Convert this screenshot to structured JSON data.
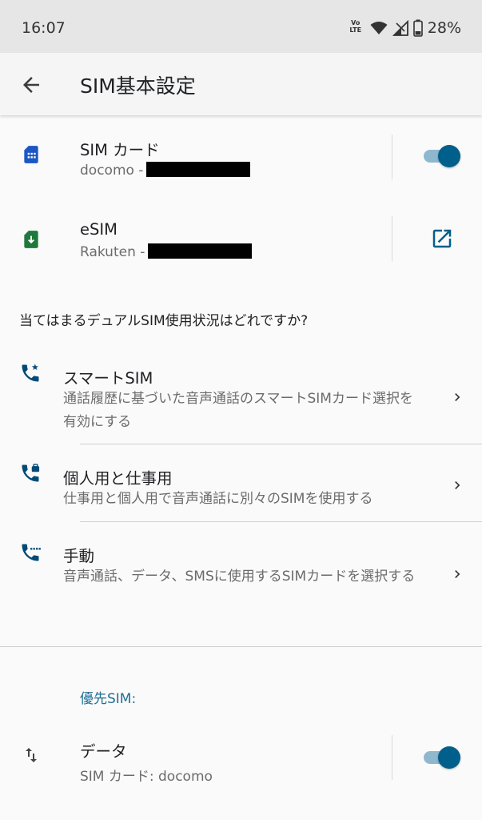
{
  "status_bar": {
    "time": "16:07",
    "volte_label": "Vo LTE",
    "battery": "28%"
  },
  "app_bar": {
    "title": "SIM基本設定"
  },
  "sims": [
    {
      "title": "SIM カード",
      "subtitle": "docomo -",
      "control": "toggle",
      "toggle_on": true,
      "icon": "sim-card-icon",
      "icon_color": "#1a56c4"
    },
    {
      "title": "eSIM",
      "subtitle": "Rakuten -",
      "control": "open-external",
      "icon": "esim-download-icon",
      "icon_color": "#1e7a3c"
    }
  ],
  "question": "当てはまるデュアルSIM使用状況はどれですか?",
  "usage_options": [
    {
      "title": "スマートSIM",
      "subtitle": "通話履歴に基づいた音声通話のスマートSIMカード選択を有効にする",
      "icon": "phone-star-icon"
    },
    {
      "title": "個人用と仕事用",
      "subtitle": "仕事用と個人用で音声通話に別々のSIMを使用する",
      "icon": "phone-briefcase-icon"
    },
    {
      "title": "手動",
      "subtitle": "音声通話、データ、SMSに使用するSIMカードを選択する",
      "icon": "phone-dialpad-icon"
    }
  ],
  "preferred": {
    "header": "優先SIM:",
    "items": [
      {
        "title": "データ",
        "subtitle": "SIM カード: docomo",
        "toggle_on": true,
        "icon": "swap-vert-icon"
      }
    ]
  },
  "colors": {
    "accent": "#005f8b",
    "toggle_track": "#8fb8cf",
    "section_header": "#1f6f95",
    "icon_blue": "#004a77"
  }
}
